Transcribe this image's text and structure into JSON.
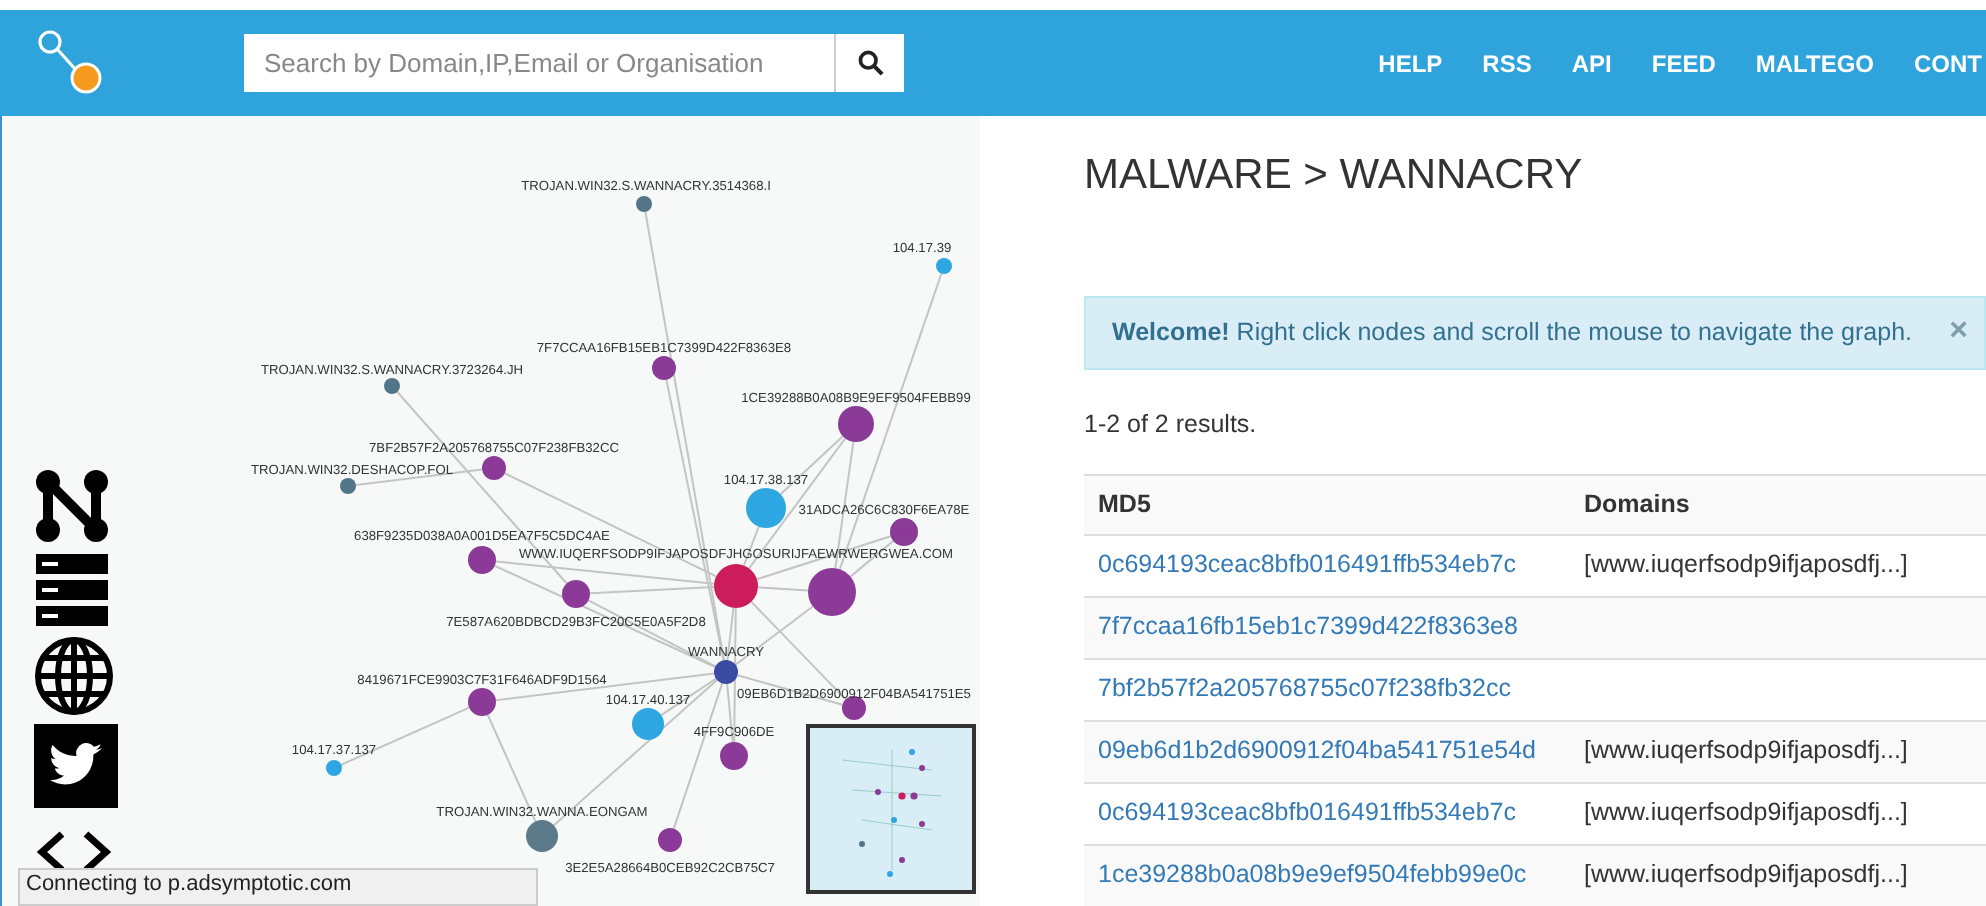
{
  "header": {
    "search": {
      "placeholder": "Search by Domain,IP,Email or Organisation"
    },
    "nav": [
      "HELP",
      "RSS",
      "API",
      "FEED",
      "MALTEGO",
      "CONT"
    ]
  },
  "graph": {
    "nodes": [
      {
        "label": "TROJAN.WIN32.S.WANNACRY.3514368.I",
        "color": "#53758a"
      },
      {
        "label": "104.17.39",
        "color": "#2da6e1"
      },
      {
        "label": "7F7CCAA16FB15EB1C7399D422F8363E8",
        "color": "#8b3a97"
      },
      {
        "label": "TROJAN.WIN32.S.WANNACRY.3723264.JH",
        "color": "#53758a"
      },
      {
        "label": "1CE39288B0A08B9E9EF9504FEBB99",
        "color": "#8b3a97"
      },
      {
        "label": "7BF2B57F2A205768755C07F238FB32CC",
        "color": "#8b3a97"
      },
      {
        "label": "TROJAN.WIN32.DESHACOP.FOL",
        "color": "#53758a"
      },
      {
        "label": "104.17.38.137",
        "color": "#2da6e1"
      },
      {
        "label": "31ADCA26C6C830F6EA78E",
        "color": "#8b3a97"
      },
      {
        "label": "638F9235D038A0A001D5EA7F5C5DC4AE",
        "color": "#8b3a97"
      },
      {
        "label": "WWW.IUQERFSODP9IFJAPOSDFJHGOSURIJFAEWRWERGWEA.COM",
        "color": "#cc1c59"
      },
      {
        "label": "7E587A620BDBCD29B3FC20C5E0A5F2D8",
        "color": "#8b3a97"
      },
      {
        "color": "#8b3a97"
      },
      {
        "label": "WANNACRY",
        "color": "#3b4ba3"
      },
      {
        "label": "8419671FCE9903C7F31F646ADF9D1564",
        "color": "#8b3a97"
      },
      {
        "label": "104.17.40.137",
        "color": "#2da6e1"
      },
      {
        "label": "09EB6D1B2D6900912F04BA541751E5",
        "color": "#8b3a97"
      },
      {
        "label": "4FF9C906DE",
        "color": "#8b3a97"
      },
      {
        "label": "104.17.37.137",
        "color": "#2da6e1"
      },
      {
        "label": "TROJAN.WIN32.WANNA.EONGAM",
        "color": "#5b7a8a"
      },
      {
        "label": "3E2E5A28664B0CEB92C2CB75C7",
        "color": "#8b3a97"
      }
    ],
    "status": "Connecting to p.adsymptotic.com"
  },
  "main": {
    "breadcrumb": "MALWARE > WANNACRY",
    "alert": {
      "message": "**Welcome!** Right click nodes and scroll the mouse to navigate the graph.",
      "close": "×"
    },
    "results": "1-2 of 2 results.",
    "table": {
      "columns": [
        "MD5",
        "Domains"
      ],
      "rows": [
        {
          "md5": "0c694193ceac8bfb016491ffb534eb7c",
          "domains": "[www.iuqerfsodp9ifjaposdfj...]"
        },
        {
          "md5": "7f7ccaa16fb15eb1c7399d422f8363e8"
        },
        {
          "md5": "7bf2b57f2a205768755c07f238fb32cc"
        },
        {
          "md5": "09eb6d1b2d6900912f04ba541751e54d",
          "domains": "[www.iuqerfsodp9ifjaposdfj...]"
        },
        {
          "md5": "0c694193ceac8bfb016491ffb534eb7c",
          "domains": "[www.iuqerfsodp9ifjaposdfj...]"
        },
        {
          "md5": "1ce39288b0a08b9e9ef9504febb99e0c",
          "domains": "[www.iuqerfsodp9ifjaposdfj...]"
        }
      ]
    }
  }
}
